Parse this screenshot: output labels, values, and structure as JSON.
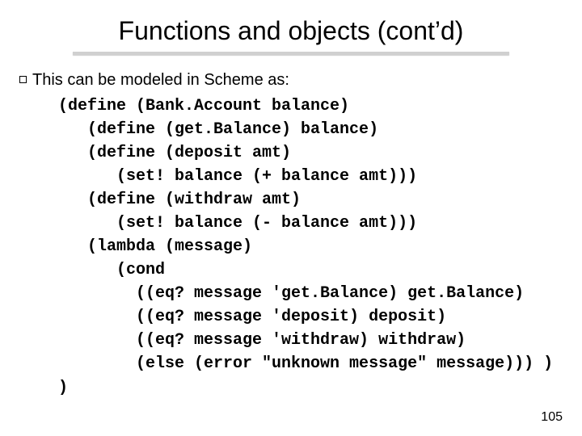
{
  "title": "Functions and objects (cont’d)",
  "lead_text": "This can be modeled in Scheme as:",
  "code_lines": [
    "(define (Bank.Account balance)",
    "   (define (get.Balance) balance)",
    "   (define (deposit amt)",
    "      (set! balance (+ balance amt)))",
    "   (define (withdraw amt)",
    "      (set! balance (- balance amt)))",
    "   (lambda (message)",
    "      (cond",
    "        ((eq? message 'get.Balance) get.Balance)",
    "        ((eq? message 'deposit) deposit)",
    "        ((eq? message 'withdraw) withdraw)",
    "        (else (error \"unknown message\" message))) )"
  ],
  "close_paren": ")",
  "page_number": "105"
}
